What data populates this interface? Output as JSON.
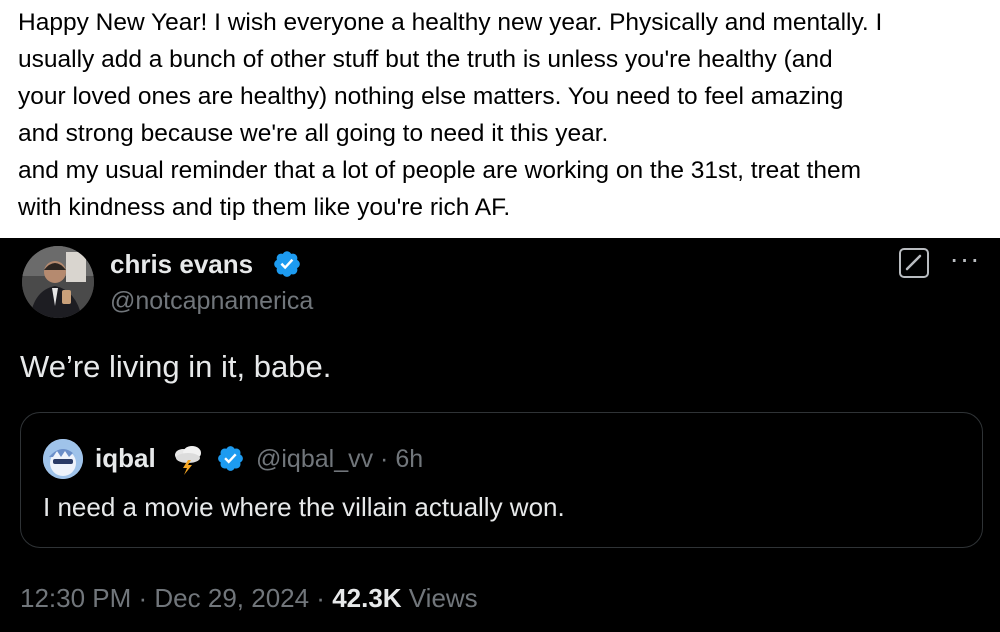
{
  "caption": {
    "text": "Happy New Year! I wish everyone a healthy new year. Physically and mentally. I\nusually add a bunch of other stuff but the truth is unless you're healthy (and\nyour loved ones are healthy) nothing else matters. You need to feel amazing\nand strong because we're all going to need it this year.\nand my usual reminder that a lot of people are working on the 31st, treat them\nwith kindness and tip them like you're rich AF."
  },
  "tweet": {
    "author": {
      "name": "chris evans",
      "handle": "@notcapnamerica",
      "verified": true
    },
    "text": "We’re living in it, babe.",
    "actions": {
      "grok_icon": "grok-icon",
      "more_label": "···"
    },
    "quote": {
      "author_name": "iqbal",
      "emoji": "cloud-with-lightning-icon",
      "verified": true,
      "meta": "@iqbal_vv · 6h",
      "text": "I need a movie where the villain actually won."
    },
    "footer": {
      "time": "12:30 PM",
      "sep1": " · ",
      "date": "Dec 29, 2024",
      "sep2": " · ",
      "views_count": "42.3K",
      "views_label": " Views"
    }
  },
  "colors": {
    "background": "#000000",
    "text_primary": "#e7e9ea",
    "text_secondary": "#71767b",
    "verified_blue": "#1d9bf0",
    "border": "#2f3336"
  }
}
